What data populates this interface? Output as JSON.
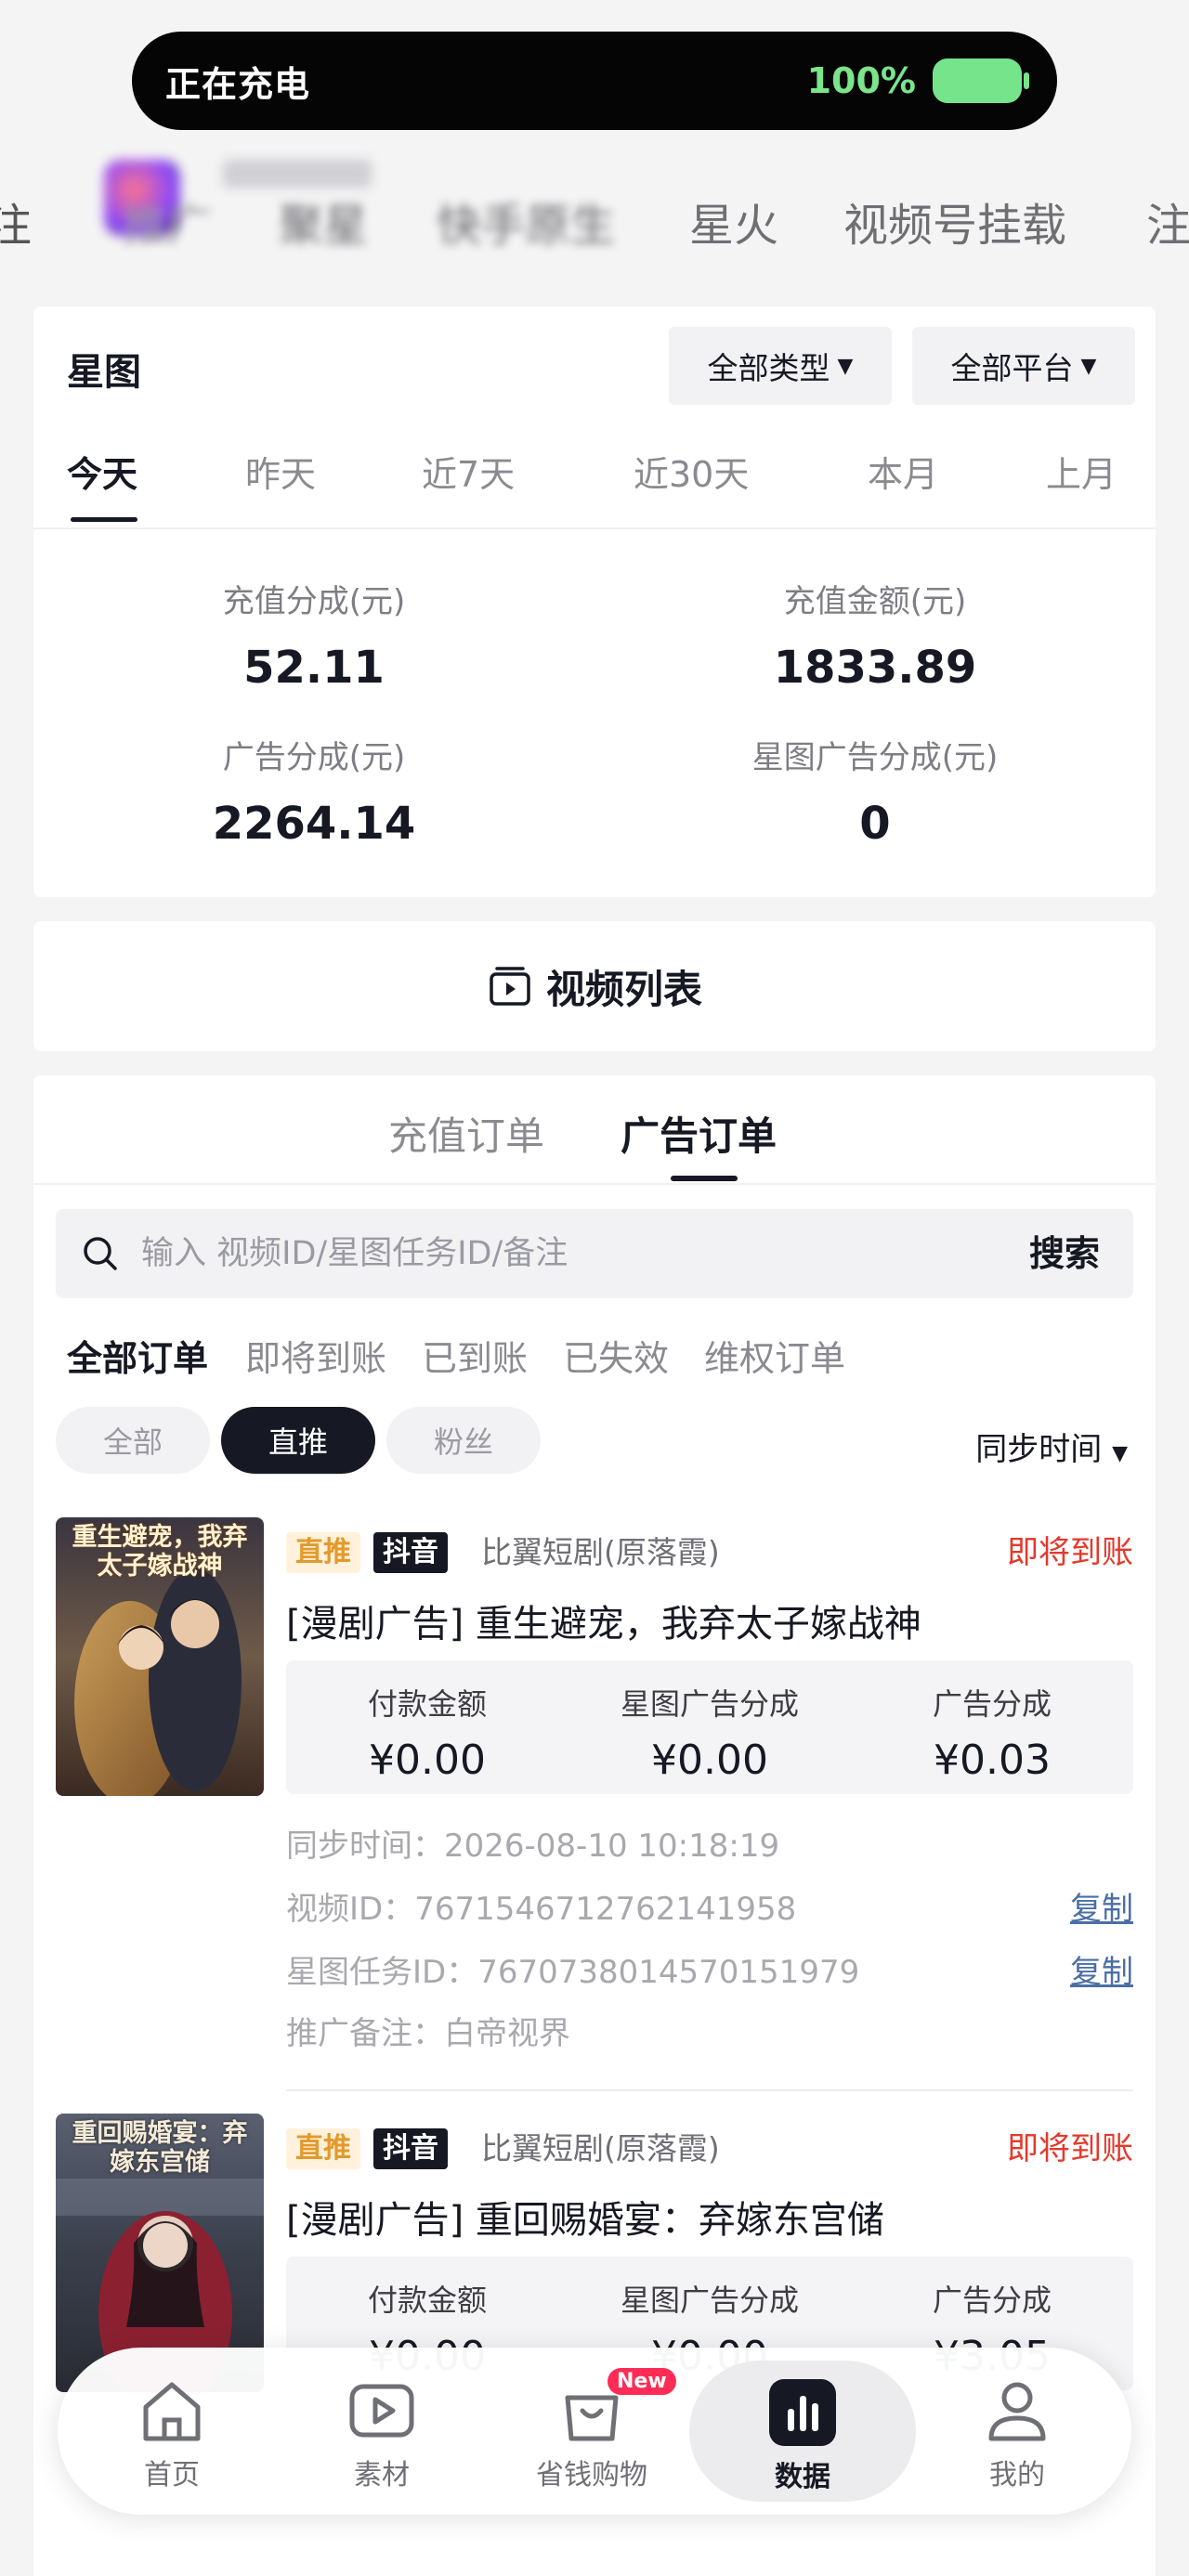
{
  "status_banner": {
    "label": "正在充电",
    "battery_pct": "100%"
  },
  "platform_tabs": [
    "推广",
    "聚星",
    "快手原生",
    "星火",
    "视频号挂载"
  ],
  "xingtu": {
    "title": "星图",
    "type_filter": "全部类型",
    "platform_filter": "全部平台",
    "date_tabs": [
      "今天",
      "昨天",
      "近7天",
      "近30天",
      "本月",
      "上月"
    ],
    "active_date_tab": "今天",
    "stats": [
      {
        "label": "充值分成(元)",
        "value": "52.11"
      },
      {
        "label": "充值金额(元)",
        "value": "1833.89"
      },
      {
        "label": "广告分成(元)",
        "value": "2264.14"
      },
      {
        "label": "星图广告分成(元)",
        "value": "0"
      }
    ]
  },
  "video_list": {
    "label": "视频列表"
  },
  "orders": {
    "tabs": [
      "充值订单",
      "广告订单"
    ],
    "active_tab": "广告订单",
    "search_placeholder": "输入 视频ID/星图任务ID/备注",
    "search_button": "搜索",
    "filter_tabs": [
      "全部订单",
      "即将到账",
      "已到账",
      "已失效",
      "维权订单"
    ],
    "chips": [
      "全部",
      "直推",
      "粉丝"
    ],
    "active_chip": "直推",
    "sort_label": "同步时间",
    "items": [
      {
        "tag": "直推",
        "platform": "抖音",
        "source": "比翼短剧(原落霞)",
        "status": "即将到账",
        "title": "[漫剧广告] 重生避宠，我弃太子嫁战神",
        "poster_text": "重生避宠，我弃太子嫁战神",
        "amount_labels": [
          "付款金额",
          "星图广告分成",
          "广告分成"
        ],
        "amounts": [
          "¥0.00",
          "¥0.00",
          "¥0.03"
        ],
        "sync_time": "同步时间：2026-08-10 10:18:19",
        "video_id": "视频ID：7671546712762141958",
        "task_id": "星图任务ID：7670738014570151979",
        "note": "推广备注：白帝视界",
        "copy_label": "复制"
      },
      {
        "tag": "直推",
        "platform": "抖音",
        "source": "比翼短剧(原落霞)",
        "status": "即将到账",
        "title": "[漫剧广告] 重回赐婚宴：弃嫁东宫储",
        "poster_text": "重回赐婚宴：弃嫁东宫储",
        "amount_labels": [
          "付款金额",
          "星图广告分成",
          "广告分成"
        ],
        "amounts": [
          "¥0.00",
          "¥0.00",
          "¥3.05"
        ]
      }
    ]
  },
  "bottom_nav": [
    {
      "label": "首页",
      "icon": "home-icon"
    },
    {
      "label": "素材",
      "icon": "play-icon"
    },
    {
      "label": "省钱购物",
      "icon": "shopping-bag-icon",
      "badge": "New"
    },
    {
      "label": "数据",
      "icon": "bar-chart-icon"
    },
    {
      "label": "我的",
      "icon": "person-icon"
    }
  ],
  "active_nav": "数据"
}
